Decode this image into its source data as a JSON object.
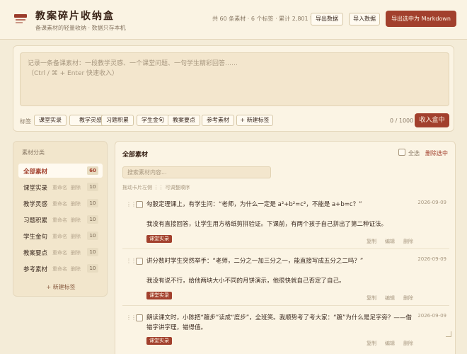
{
  "header": {
    "title": "教案碎片收纳盒",
    "subtitle": "备课素材的轻量收纳 · 数据只存本机",
    "stats": "共 60 条素材 · 6 个标签 · 累计 2,801 字",
    "export_label": "导出数据",
    "import_label": "导入数据",
    "export_md_label": "导出选中为 Markdown"
  },
  "composer": {
    "placeholder": "记录一条备课素材：一段教学灵感、一个课堂问题、一句学生精彩回答……\n（Ctrl / ⌘ + Enter 快速收入）",
    "tags_label": "标签",
    "tags": [
      "课堂实录",
      "教学灵感",
      "习题积累",
      "学生金句",
      "教案要点",
      "参考素材"
    ],
    "new_tag_label": "+ 新建标签",
    "char_count": "0 / 1000",
    "submit_label": "收入盒中"
  },
  "sidebar": {
    "title": "素材分类",
    "rename_label": "重命名",
    "delete_label": "删除",
    "items": [
      {
        "label": "全部素材",
        "count": "60"
      },
      {
        "label": "课堂实录",
        "count": "10"
      },
      {
        "label": "教学灵感",
        "count": "10"
      },
      {
        "label": "习题积累",
        "count": "10"
      },
      {
        "label": "学生金句",
        "count": "10"
      },
      {
        "label": "教案要点",
        "count": "10"
      },
      {
        "label": "参考素材",
        "count": "10"
      }
    ],
    "new_category_label": "+ 新建标签"
  },
  "main": {
    "title": "全部素材",
    "select_all_label": "全选",
    "delete_selected_label": "删除选中",
    "search_placeholder": "搜索素材内容...",
    "drag_hint": "拖动卡片左侧 ⋮⋮ 可调整顺序",
    "actions": {
      "copy": "复制",
      "edit": "编辑",
      "delete": "删除"
    },
    "cards": [
      {
        "text": "勾股定理课上，有学生问：“老师，为什么一定是 a²+b²=c²，不能是 a+b=c？”\n\n我没有直接回答，让学生用方格纸剪拼验证。下课前，有两个孩子自己拼出了第二种证法。",
        "date": "2026-09-09",
        "tag": "课堂实录"
      },
      {
        "text": "讲分数时学生突然举手：“老师，二分之一加三分之一，能直接写成五分之二吗？”\n\n我没有说不行，给他两块大小不同的月饼演示，他很快就自己否定了自己。",
        "date": "2026-09-09",
        "tag": "课堂实录"
      },
      {
        "text": "朗读课文时，小陈把“踱步”读成“度步”，全班笑。我顺势考了考大家：“踱”为什么是足字旁？——借错字讲字理，错得值。",
        "date": "2026-09-09",
        "tag": "课堂实录"
      }
    ]
  },
  "colors": {
    "accent": "#a2402d",
    "background": "#f4ecd8",
    "panel": "#fbf4e4"
  }
}
